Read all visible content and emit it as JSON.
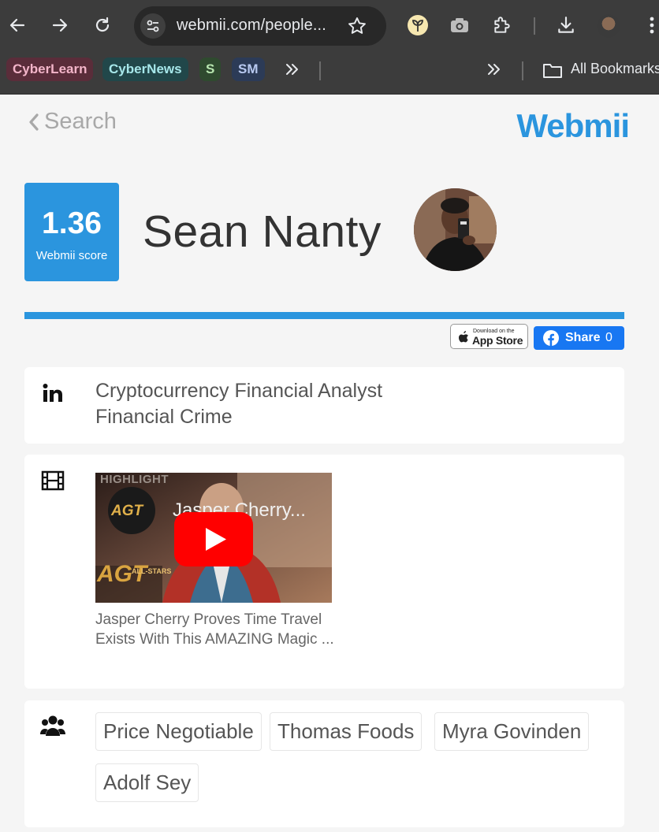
{
  "browser": {
    "url_display": "webmii.com/people...",
    "bookmarks": [
      {
        "label": "CyberLearn",
        "bg": "#5a2d3a",
        "fg": "#f3b5c9"
      },
      {
        "label": "CyberNews",
        "bg": "#21474a",
        "fg": "#a6e7ea"
      },
      {
        "label": "S",
        "bg": "#2f4a2f",
        "fg": "#b8e6b0"
      },
      {
        "label": "SM",
        "bg": "#2c3b57",
        "fg": "#b8c9f0"
      }
    ],
    "all_bookmarks_label": "All Bookmarks"
  },
  "page": {
    "back_label": "Search",
    "logo": "Webmii",
    "accent_color": "#2b95de"
  },
  "profile": {
    "score": "1.36",
    "score_label": "Webmii score",
    "name": "Sean Nanty"
  },
  "actions": {
    "appstore_small": "Download on the",
    "appstore_big": "App Store",
    "share_label": "Share",
    "share_count": "0"
  },
  "linkedin_card": {
    "icon": "linkedin-icon",
    "lines": [
      "Cryptocurrency Financial Analyst",
      "Financial Crime"
    ]
  },
  "video_card": {
    "icon": "film-icon",
    "thumb_overlay_title": "Jasper Cherry...",
    "thumb_highlight": "HIGHLIGHT",
    "thumb_logo": "AGT",
    "thumb_logo_sub": "ALL-STARS",
    "caption": "Jasper Cherry Proves Time Travel Exists With This AMAZING Magic ..."
  },
  "people_card": {
    "icon": "users-icon",
    "tags": [
      "Price Negotiable",
      "Thomas Foods",
      "Myra Govinden",
      "Adolf Sey"
    ]
  }
}
